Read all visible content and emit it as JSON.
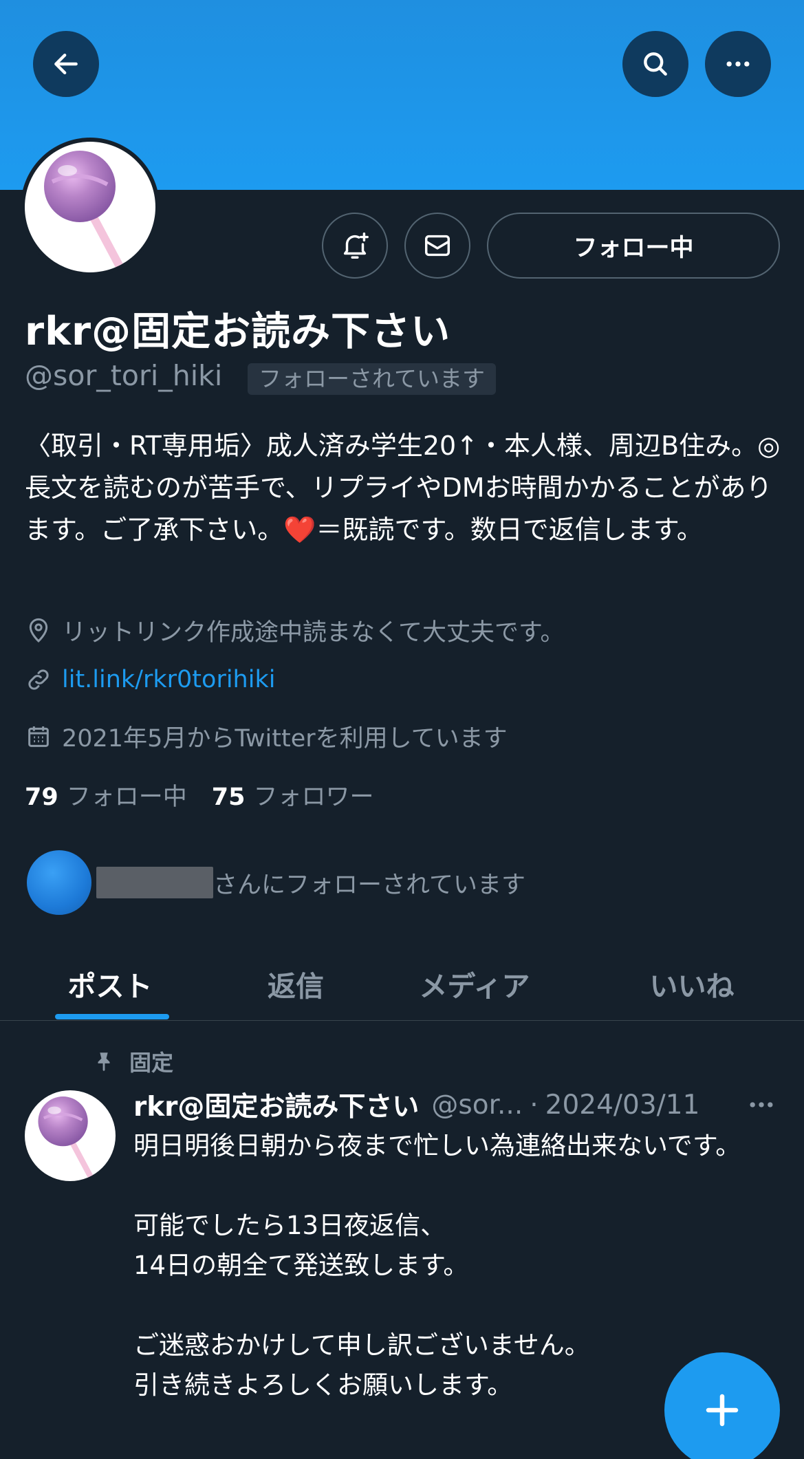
{
  "colors": {
    "accent": "#1d9bf0",
    "background": "#15202b",
    "muted": "#8b98a5",
    "border": "#536471"
  },
  "header": {
    "back_icon": "arrow-left-icon",
    "search_icon": "search-icon",
    "more_icon": "more-horizontal-icon"
  },
  "profile": {
    "display_name": "rkr@固定お読み下さい",
    "handle": "@sor_tori_hiki",
    "follows_you_badge": "フォローされています",
    "avatar_icon": "lollipop-icon",
    "bio": "〈取引・RT専用垢〉成人済み学生20↑・本人様、周辺B住み。◎長文を読むのが苦手で、リプライやDMお時間かかることがあります。ご了承下さい。❤️＝既読です。数日で返信します。",
    "location": "リットリンク作成途中読まなくて大丈夫です。",
    "link": "lit.link/rkr0torihiki",
    "joined": "2021年5月からTwitterを利用しています",
    "following_count": "79",
    "following_label": "フォロー中",
    "followers_count": "75",
    "followers_label": "フォロワー",
    "followed_by_text": "さんにフォローされています"
  },
  "actions": {
    "notify_icon": "bell-plus-icon",
    "message_icon": "mail-icon",
    "following_button": "フォロー中"
  },
  "tabs": [
    {
      "label": "ポスト",
      "active": true
    },
    {
      "label": "返信",
      "active": false
    },
    {
      "label": "メディア",
      "active": false
    },
    {
      "label": "いいね",
      "active": false
    }
  ],
  "post": {
    "pinned_label": "固定",
    "author_name": "rkr@固定お読み下さい",
    "author_handle": "@sor...",
    "separator": "·",
    "date": "2024/03/11",
    "body": "明日明後日朝から夜まで忙しい為連絡出来ないです。\n\n可能でしたら13日夜返信、\n14日の朝全て発送致します。\n\nご迷惑おかけして申し訳ございません。\n引き続きよろしくお願いします。"
  },
  "fab": {
    "icon": "plus-icon"
  }
}
